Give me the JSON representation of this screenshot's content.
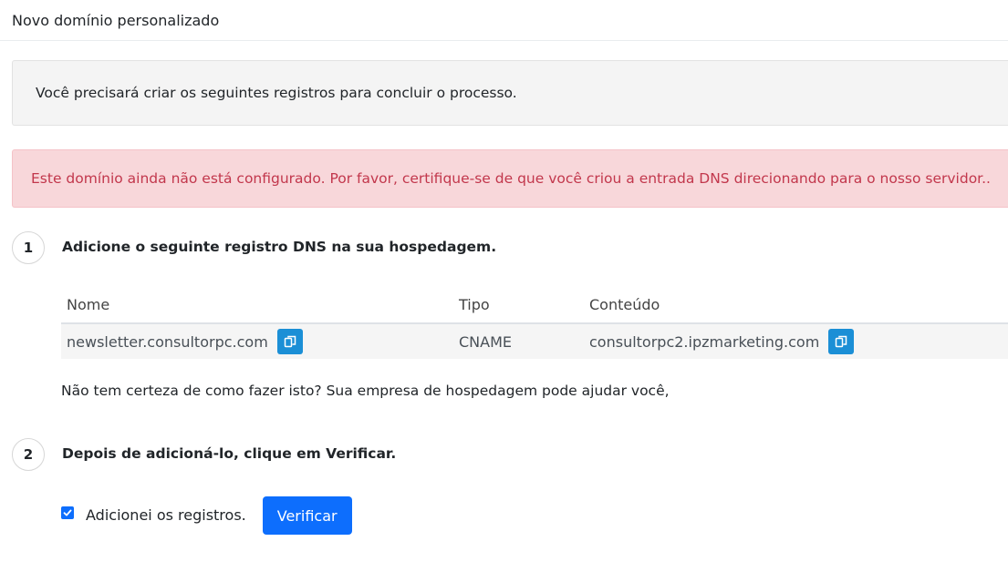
{
  "header": {
    "title": "Novo domínio personalizado"
  },
  "info_message": "Você precisará criar os seguintes registros para concluir o processo.",
  "alert_message": "Este domínio ainda não está configurado. Por favor, certifique-se de que você criou a entrada DNS direcionando para o nosso servidor..",
  "steps": [
    {
      "number": "1",
      "title": "Adicione o seguinte registro DNS na sua hospedagem."
    },
    {
      "number": "2",
      "title": "Depois de adicioná-lo, clique em Verificar."
    }
  ],
  "dns_table": {
    "columns": [
      "Nome",
      "Tipo",
      "Conteúdo"
    ],
    "rows": [
      {
        "nome": "newsletter.consultorpc.com",
        "tipo": "CNAME",
        "conteudo": "consultorpc2.ipzmarketing.com"
      }
    ]
  },
  "help_text": "Não tem certeza de como fazer isto? Sua empresa de hospedagem pode ajudar você,",
  "confirm": {
    "checkbox_label": "Adicionei os registros.",
    "checked": true,
    "button_label": "Verificar"
  },
  "colors": {
    "primary": "#0d6efd",
    "copy_button": "#1b8fd6",
    "alert_bg": "#f8d7da",
    "alert_text": "#c2374c"
  },
  "icons": {
    "copy": "copy-icon",
    "check": "checkmark-icon"
  }
}
